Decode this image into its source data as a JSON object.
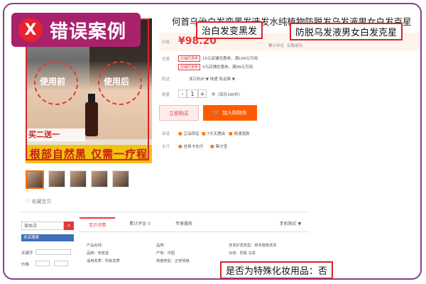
{
  "badge": {
    "x_mark": "X",
    "text": "错误案例"
  },
  "product_image": {
    "before_label": "使用前",
    "after_label": "使用后",
    "promo_top": "买二送一",
    "promo_bottom": "根部自然黑 仅需一疗程"
  },
  "thumbnails_count": 5,
  "share_label": "收藏宝贝",
  "product": {
    "title": "何首乌治白发变黑发选发水纯植物防脱发乌发液男女白发克星",
    "price": "¥98.20",
    "sales_label": "累计评论",
    "reviews_label": "交易成功",
    "price_label": "价格",
    "promo_label": "优惠",
    "promo_line_1": "10元店铺优惠券，满199元可用",
    "promo_line_2": "5元店铺优惠券，满99元可用",
    "promo_tag": "店铺优惠券",
    "ship_label": "配送",
    "ship_text": "浙江杭州 ▼  快递 免运费 ▼",
    "qty_label": "数量",
    "qty_minus": "-",
    "qty_value": "1",
    "qty_plus": "+",
    "stock_text": "件（库存390件）",
    "buy_now": "立即购买",
    "add_to_cart": "加入购物车",
    "cart_icon": "cart-icon",
    "service_label": "承诺",
    "service_items": [
      "正品保证",
      "7天无理由",
      "极速退款"
    ],
    "pay_label": "支付",
    "pay_items": [
      "信用卡支付",
      "集分宝"
    ]
  },
  "callouts": {
    "hair_claim": "治白发变黑发",
    "hair_loss_claim": "防脱乌发液男女白发克星",
    "special_cosmetic": "是否为特殊化妆用品：否"
  },
  "sidebar": {
    "search_placeholder": "搜本店",
    "search_icon": "search-icon",
    "category_header": "本店搜索",
    "keyword_label": "关键字",
    "price_label": "价格"
  },
  "tabs": [
    {
      "label": "宝贝详情",
      "active": true
    },
    {
      "label": "累计评论",
      "count": "0"
    },
    {
      "label": "专享服务"
    }
  ],
  "tab_right": "手机购买 ▼",
  "specs": {
    "col1": [
      "产品名称：",
      "品牌：安宫堂",
      "适用发质：所有发质"
    ],
    "col2": [
      "品牌：",
      "产地：中国",
      "规格类型：正常规格"
    ],
    "col3": [
      "洗发护发类型：草本植物洗发",
      "功效：防脱 乌发",
      "是否为特殊化妆用品：否"
    ]
  },
  "colors": {
    "frame": "#8a3f8c",
    "badge": "#a9216d",
    "error_x": "#e8222e",
    "highlight": "#d9242a",
    "price": "#e4393c",
    "cart_button": "#ff5a00",
    "promo_strip": "#f3c20f"
  }
}
